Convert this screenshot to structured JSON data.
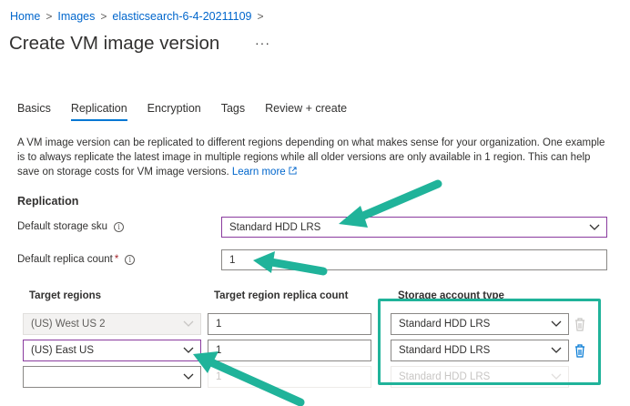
{
  "breadcrumb": {
    "items": [
      "Home",
      "Images",
      "elasticsearch-6-4-20211109"
    ],
    "separator": ">"
  },
  "page": {
    "title": "Create VM image version",
    "more": "···"
  },
  "tabs": [
    {
      "label": "Basics",
      "active": false
    },
    {
      "label": "Replication",
      "active": true
    },
    {
      "label": "Encryption",
      "active": false
    },
    {
      "label": "Tags",
      "active": false
    },
    {
      "label": "Review + create",
      "active": false
    }
  ],
  "description": {
    "text": "A VM image version can be replicated to different regions depending on what makes sense for your organization. One example is to always replicate the latest image in multiple regions while all older versions are only available in 1 region. This can help save on storage costs for VM image versions.",
    "link": "Learn more"
  },
  "replication": {
    "heading": "Replication",
    "storage_sku_label": "Default storage sku",
    "storage_sku_value": "Standard HDD LRS",
    "replica_count_label": "Default replica count",
    "required_mark": "*",
    "replica_count_value": "1",
    "info_glyph": "i"
  },
  "table": {
    "headers": {
      "regions": "Target regions",
      "count": "Target region replica count",
      "storage": "Storage account type"
    },
    "rows": [
      {
        "region": "(US) West US 2",
        "count": "1",
        "storage": "Standard HDD LRS",
        "state": "disabled"
      },
      {
        "region": "(US) East US",
        "count": "1",
        "storage": "Standard HDD LRS",
        "state": "focused"
      },
      {
        "region": "",
        "count": "1",
        "storage": "Standard HDD LRS",
        "state": "empty"
      }
    ]
  },
  "colors": {
    "link": "#0066cc",
    "accent": "#0078d4",
    "annotation": "#20b39a",
    "focus_border": "#8a3b9e"
  },
  "icons": [
    "info-icon",
    "chevron-down-icon",
    "trash-icon",
    "ellipsis-icon",
    "arrow-annotation",
    "external-link-icon"
  ]
}
